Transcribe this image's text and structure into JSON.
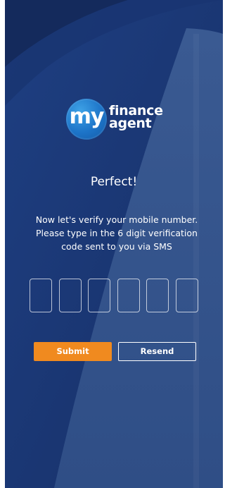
{
  "brand": {
    "logo_mark": "my",
    "logo_word_1": "finance",
    "logo_word_2": "agent"
  },
  "screen": {
    "heading": "Perfect!",
    "instructions": [
      "Now let's verify your mobile number.",
      "Please type in the 6 digit verification",
      "code sent to you via SMS"
    ]
  },
  "verification": {
    "digits": [
      "",
      "",
      "",
      "",
      "",
      ""
    ]
  },
  "actions": {
    "submit_label": "Submit",
    "resend_label": "Resend"
  },
  "colors": {
    "background": "#1b3a77",
    "accent": "#f08a1f",
    "logo_blue": "#1d74c8",
    "text": "#ffffff"
  }
}
